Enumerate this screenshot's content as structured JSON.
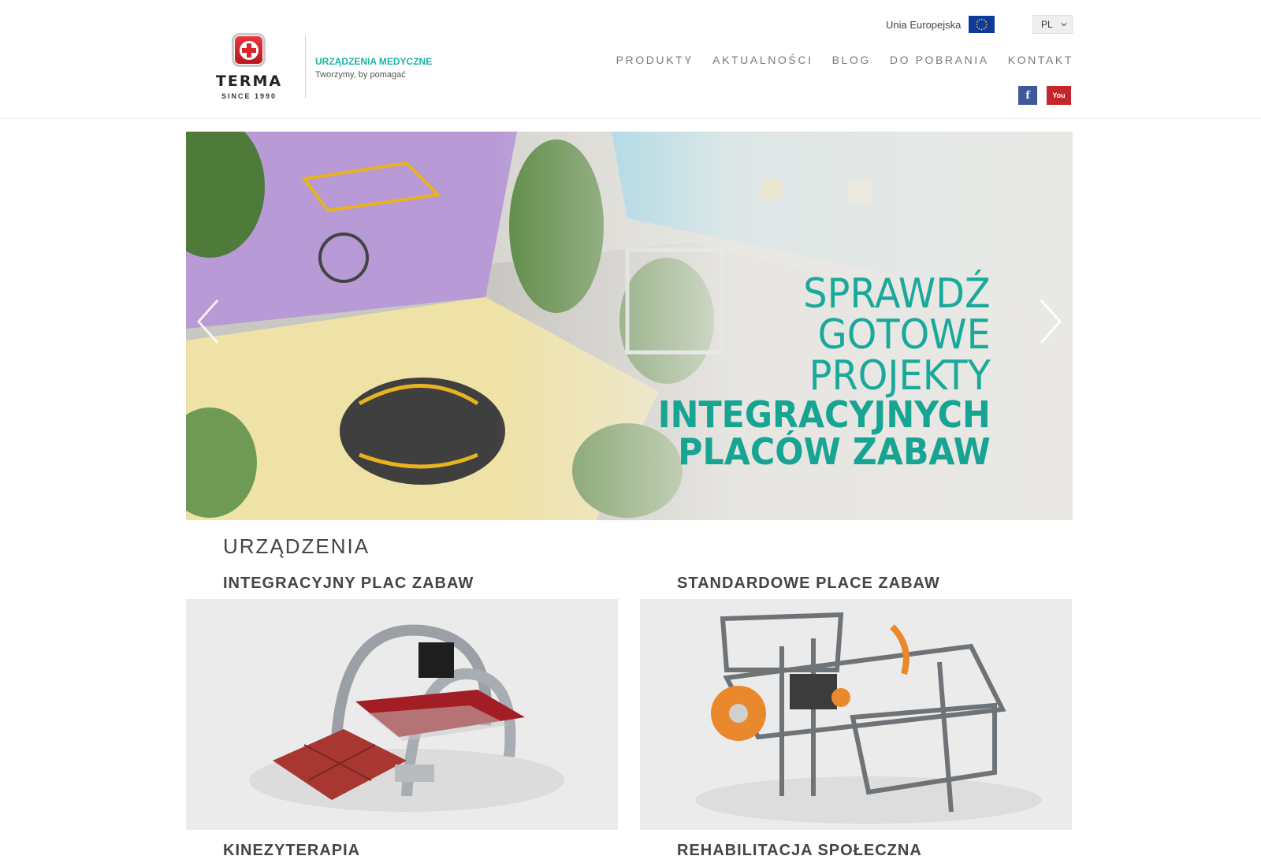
{
  "header": {
    "logo": {
      "word": "TERMA",
      "since": "SINCE 1990"
    },
    "tagline_title": "URZĄDZENIA MEDYCZNE",
    "tagline_sub": "Tworzymy, by pomagać",
    "eu_label": "Unia Europejska",
    "language": "PL",
    "nav": [
      "PRODUKTY",
      "AKTUALNOŚCI",
      "BLOG",
      "DO POBRANIA",
      "KONTAKT"
    ],
    "social": {
      "facebook": "f",
      "youtube": "You"
    }
  },
  "slider": {
    "lines": [
      "SPRAWDŹ",
      "GOTOWE",
      "PROJEKTY"
    ],
    "bold_lines": [
      "INTEGRACYJNYCH",
      "PLACÓW ZABAW"
    ]
  },
  "section": {
    "title": "URZĄDZENIA",
    "categories": [
      "INTEGRACYJNY PLAC ZABAW",
      "STANDARDOWE PLACE ZABAW",
      "KINEZYTERAPIA",
      "REHABILITACJA SPOŁECZNA"
    ]
  },
  "colors": {
    "accent": "#1fb3a4",
    "brand_red": "#d8242a",
    "facebook": "#3b5a99",
    "youtube": "#c4252b",
    "eu_blue": "#0e3b9b"
  }
}
